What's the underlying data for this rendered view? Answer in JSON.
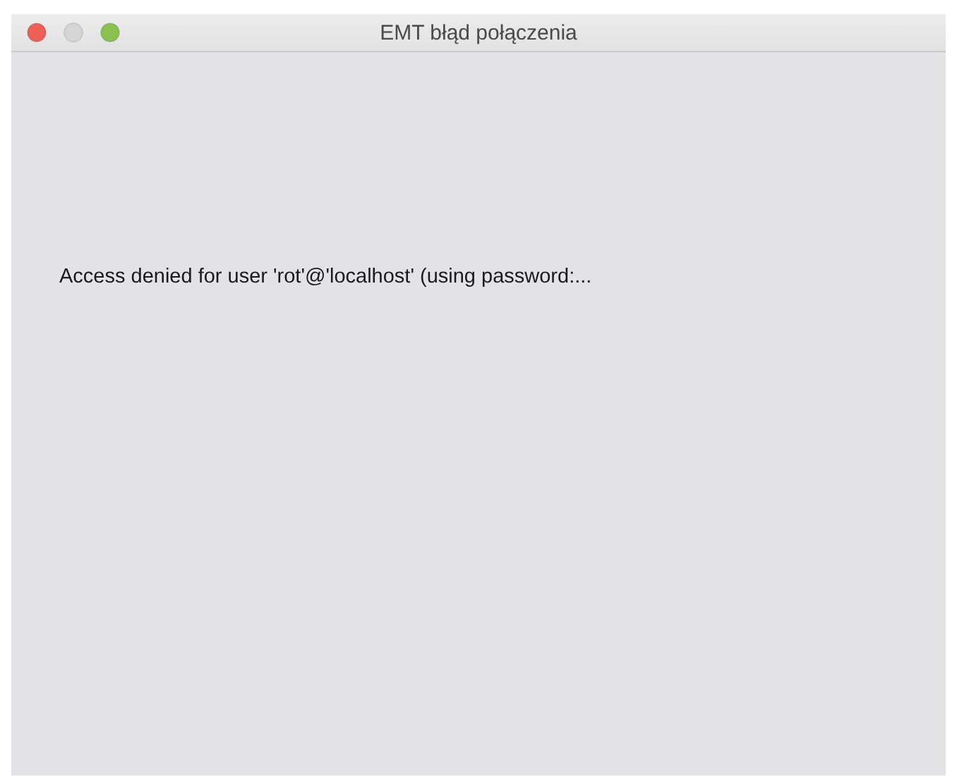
{
  "window": {
    "title": "EMT błąd połączenia",
    "controls": [
      {
        "kind": "close",
        "disabled": false
      },
      {
        "kind": "minimize",
        "disabled": true
      },
      {
        "kind": "zoom",
        "disabled": false
      }
    ]
  },
  "message": "Access denied for user 'rot'@'localhost' (using password:..."
}
